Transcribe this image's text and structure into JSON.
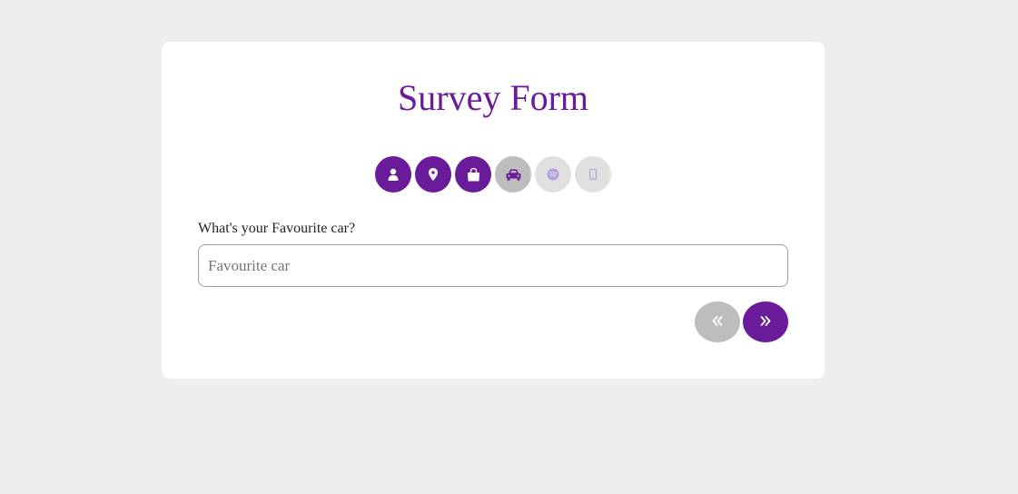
{
  "form": {
    "title": "Survey Form",
    "question": "What's your Favourite car?",
    "answer_value": "",
    "answer_placeholder": "Favourite car"
  },
  "steps": [
    {
      "icon": "user-icon",
      "state": "done"
    },
    {
      "icon": "map-marker-icon",
      "state": "done"
    },
    {
      "icon": "shopping-bag-icon",
      "state": "done"
    },
    {
      "icon": "car-icon",
      "state": "current"
    },
    {
      "icon": "spotify-icon",
      "state": "todo"
    },
    {
      "icon": "mobile-phone-icon",
      "state": "todo"
    }
  ],
  "navigation": {
    "prev_icon": "double-chevron-left-icon",
    "next_icon": "double-chevron-right-icon"
  },
  "colors": {
    "accent": "#6a1b9a",
    "background": "#eeeeee",
    "card": "#ffffff",
    "step_current": "#bdbdbd",
    "step_todo": "#e0e0e0"
  }
}
